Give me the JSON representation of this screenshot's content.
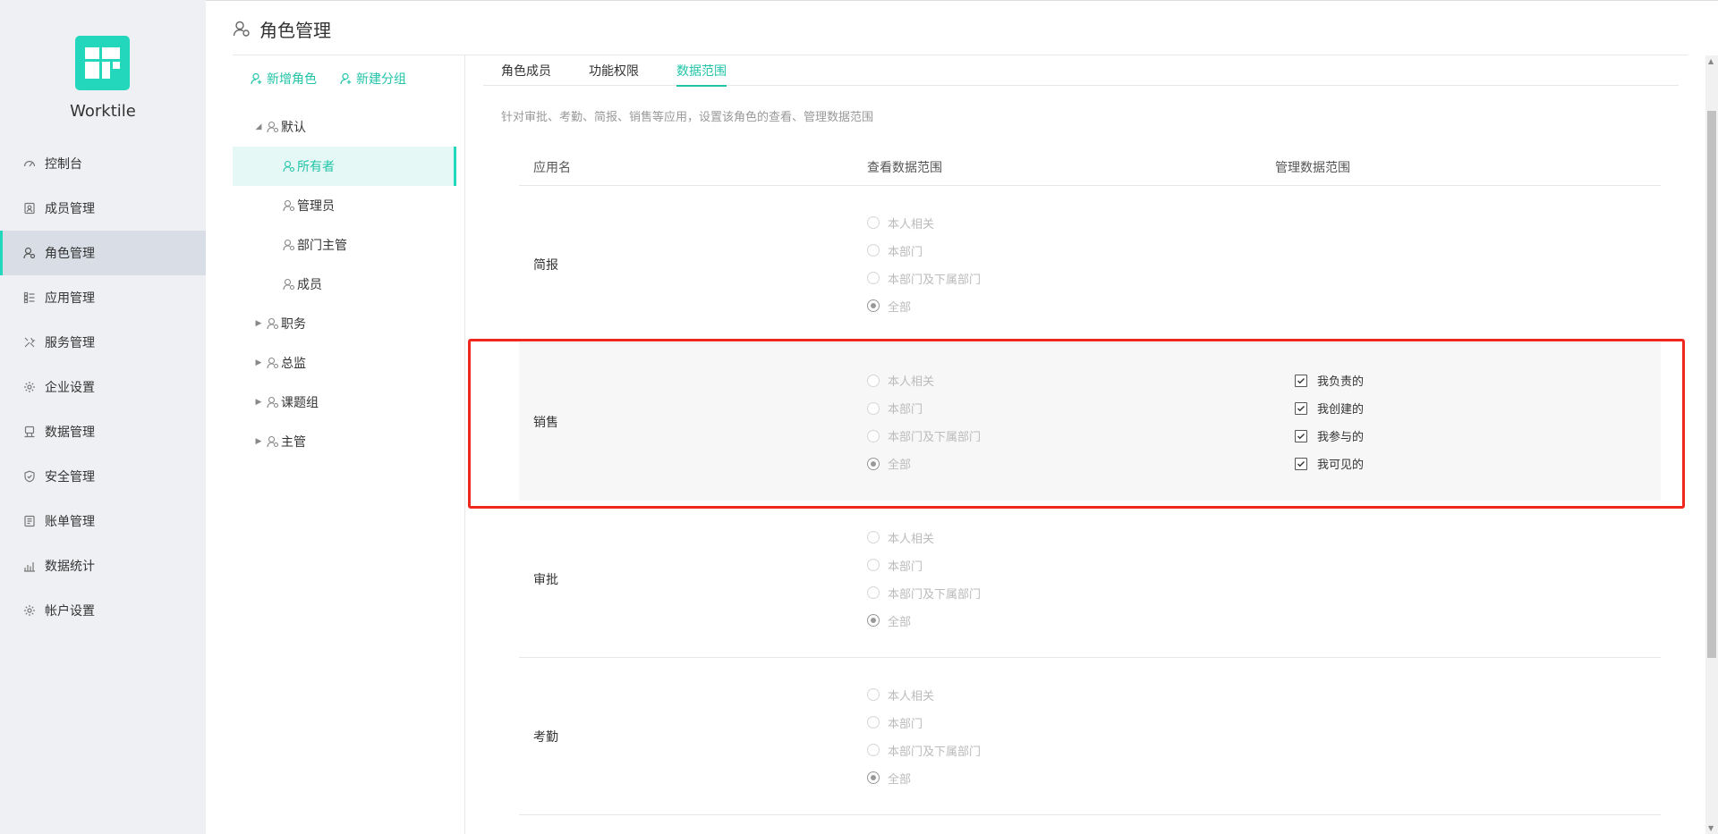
{
  "app": {
    "name": "Worktile",
    "brand_color": "#22d7bb"
  },
  "nav": [
    {
      "label": "控制台",
      "icon": "dashboard-icon"
    },
    {
      "label": "成员管理",
      "icon": "member-icon"
    },
    {
      "label": "角色管理",
      "icon": "role-icon",
      "active": true
    },
    {
      "label": "应用管理",
      "icon": "apps-icon"
    },
    {
      "label": "服务管理",
      "icon": "tools-icon"
    },
    {
      "label": "企业设置",
      "icon": "gear-icon"
    },
    {
      "label": "数据管理",
      "icon": "database-icon"
    },
    {
      "label": "安全管理",
      "icon": "shield-icon"
    },
    {
      "label": "账单管理",
      "icon": "bill-icon"
    },
    {
      "label": "数据统计",
      "icon": "chart-icon"
    },
    {
      "label": "帐户设置",
      "icon": "gear-icon"
    }
  ],
  "header": {
    "title": "角色管理"
  },
  "roles": {
    "add_role": "新增角色",
    "add_group": "新建分组",
    "tree": [
      {
        "label": "默认",
        "level": 0,
        "expanded": true
      },
      {
        "label": "所有者",
        "level": 1,
        "active": true
      },
      {
        "label": "管理员",
        "level": 1
      },
      {
        "label": "部门主管",
        "level": 1
      },
      {
        "label": "成员",
        "level": 1
      },
      {
        "label": "职务",
        "level": 0,
        "expanded": false
      },
      {
        "label": "总监",
        "level": 0,
        "expanded": false
      },
      {
        "label": "课题组",
        "level": 0,
        "expanded": false
      },
      {
        "label": "主管",
        "level": 0,
        "expanded": false
      }
    ]
  },
  "tabs": [
    {
      "label": "角色成员"
    },
    {
      "label": "功能权限"
    },
    {
      "label": "数据范围",
      "active": true
    }
  ],
  "description": "针对审批、考勤、简报、销售等应用，设置该角色的查看、管理数据范围",
  "table": {
    "headers": {
      "app": "应用名",
      "view": "查看数据范围",
      "manage": "管理数据范围"
    },
    "view_options": [
      "本人相关",
      "本部门",
      "本部门及下属部门",
      "全部"
    ],
    "rows": [
      {
        "app": "简报",
        "view_selected": "全部",
        "manage": []
      },
      {
        "app": "销售",
        "view_selected": "全部",
        "highlighted": true,
        "manage": [
          "我负责的",
          "我创建的",
          "我参与的",
          "我可见的"
        ]
      },
      {
        "app": "审批",
        "view_selected": "全部",
        "manage": []
      },
      {
        "app": "考勤",
        "view_selected": "全部",
        "manage": []
      }
    ]
  }
}
